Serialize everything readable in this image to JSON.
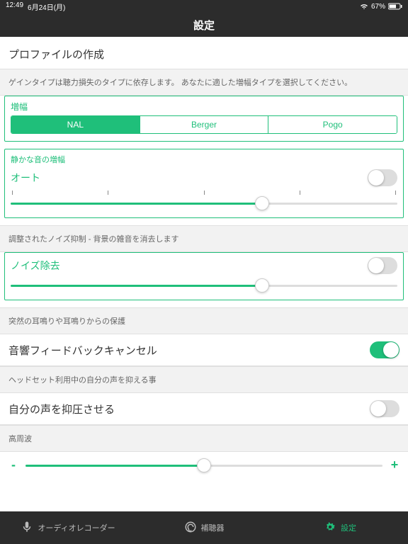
{
  "status": {
    "time": "12:49",
    "date": "6月24日(月)",
    "battery": "67%"
  },
  "nav": {
    "title": "設定"
  },
  "profile": {
    "header": "プロファイルの作成"
  },
  "gain": {
    "caption": "ゲインタイプは聴力損失のタイプに依存します。 あなたに適した増幅タイプを選択してください。",
    "title": "増幅",
    "options": [
      "NAL",
      "Berger",
      "Pogo"
    ],
    "selected": 0
  },
  "quiet": {
    "title": "静かな音の増幅",
    "value_label": "オート",
    "toggle": false,
    "slider": 65
  },
  "noise": {
    "caption": "調整されたノイズ抑制 - 背景の雑音を消去します",
    "title": "ノイズ除去",
    "toggle": false,
    "slider": 65
  },
  "feedback": {
    "caption": "突然の耳鳴りや耳鳴りからの保護",
    "label": "音響フィードバックキャンセル",
    "toggle": true
  },
  "ownvoice": {
    "caption": "ヘッドセット利用中の自分の声を抑える事",
    "label": "自分の声を抑圧させる",
    "toggle": false
  },
  "highfreq": {
    "caption": "高周波",
    "minus": "-",
    "plus": "+",
    "slider": 50
  },
  "tabs": {
    "items": [
      {
        "label": "オーディオレコーダー"
      },
      {
        "label": "補聴器"
      },
      {
        "label": "設定"
      }
    ],
    "active": 2
  }
}
